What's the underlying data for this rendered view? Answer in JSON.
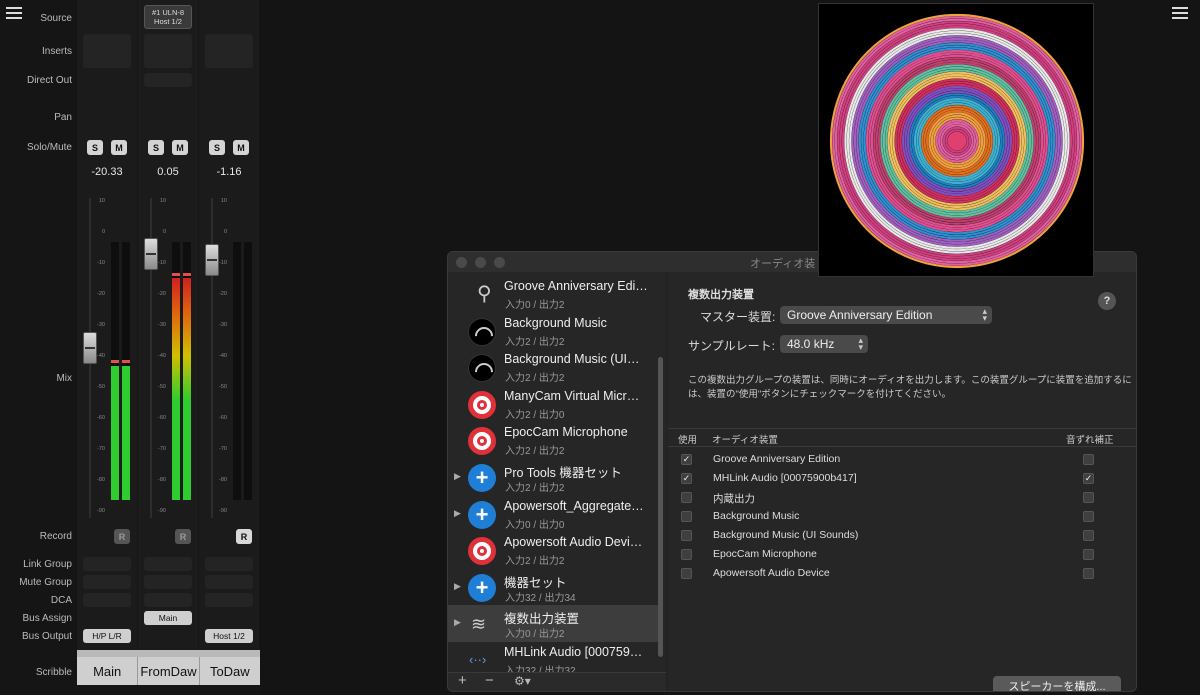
{
  "mixer": {
    "row_labels": {
      "source": "Source",
      "inserts": "Inserts",
      "direct_out": "Direct Out",
      "pan": "Pan",
      "solo_mute": "Solo/Mute",
      "mix": "Mix",
      "record": "Record",
      "link_group": "Link Group",
      "mute_group": "Mute Group",
      "dca": "DCA",
      "bus_assign": "Bus Assign",
      "bus_output": "Bus Output",
      "scribble": "Scribble"
    },
    "solo_label": "S",
    "mute_label": "M",
    "record_label": "R",
    "scale_labels": [
      "10",
      "0",
      "-10",
      "-20",
      "-30",
      "-40",
      "-50",
      "-60",
      "-70",
      "-80",
      "-90"
    ],
    "channels": [
      {
        "level": "-20.33",
        "scribble": "Main",
        "bus_output": "H/P L/R",
        "bus_assign": "",
        "record_armed": false,
        "meter": 0.52
      },
      {
        "level": "0.05",
        "scribble": "FromDaw",
        "source": "#1 ULN-8\nHost 1/2",
        "source_line1": "#1 ULN-8",
        "source_line2": "Host 1/2",
        "bus_output": "",
        "bus_assign": "Main",
        "record_armed": false,
        "meter": 0.86
      },
      {
        "level": "-1.16",
        "scribble": "ToDaw",
        "bus_output": "Host 1/2",
        "bus_assign": "",
        "record_armed": true,
        "meter": 0.0
      }
    ]
  },
  "window": {
    "title": "オーディオ装",
    "devices": [
      {
        "name": "Groove Anniversary Edi…",
        "sub": "入力0 / 出力2",
        "icon": "usb-icon"
      },
      {
        "name": "Background Music",
        "sub": "入力2 / 出力2",
        "icon": "background-music-icon"
      },
      {
        "name": "Background Music (UI…",
        "sub": "入力2 / 出力2",
        "icon": "background-music-icon"
      },
      {
        "name": "ManyCam Virtual Micr…",
        "sub": "入力2 / 出力0",
        "icon": "target-icon"
      },
      {
        "name": "EpocCam Microphone",
        "sub": "入力2 / 出力2",
        "icon": "target-icon"
      },
      {
        "name": "Pro Tools 機器セット",
        "sub": "入力2 / 出力2",
        "icon": "plus-icon"
      },
      {
        "name": "Apowersoft_Aggregate…",
        "sub": "入力0 / 出力0",
        "icon": "plus-icon"
      },
      {
        "name": "Apowersoft Audio Devi…",
        "sub": "入力2 / 出力2",
        "icon": "target-icon"
      },
      {
        "name": "機器セット",
        "sub": "入力32 / 出力34",
        "icon": "plus-icon"
      },
      {
        "name": "複数出力装置",
        "sub": "入力0 / 出力2",
        "icon": "multi-output-icon"
      },
      {
        "name": "MHLink Audio [000759…",
        "sub": "入力32 / 出力32",
        "icon": "mhlink-icon"
      }
    ],
    "bottom": {
      "add": "+",
      "remove": "−",
      "gear": "⚙︎▾"
    },
    "detail": {
      "title": "複数出力装置",
      "master_label": "マスター装置:",
      "master_value": "Groove Anniversary Edition",
      "rate_label": "サンプルレート:",
      "rate_value": "48.0 kHz",
      "help": "?",
      "description": "この複数出力グループの装置は、同時にオーディオを出力します。この装置グループに装置を追加するには、装置の\"使用\"ボタンにチェックマークを付けてください。",
      "col_use": "使用",
      "col_device": "オーディオ装置",
      "col_drift": "音ずれ補正",
      "rows": [
        {
          "name": "Groove Anniversary Edition",
          "use": true,
          "drift": false
        },
        {
          "name": "MHLink Audio [00075900b417]",
          "use": true,
          "drift": true
        },
        {
          "name": "内蔵出力",
          "use": false,
          "drift": false
        },
        {
          "name": "Background Music",
          "use": false,
          "drift": false
        },
        {
          "name": "Background Music (UI Sounds)",
          "use": false,
          "drift": false
        },
        {
          "name": "EpocCam Microphone",
          "use": false,
          "drift": false
        },
        {
          "name": "Apowersoft Audio Device",
          "use": false,
          "drift": false
        }
      ],
      "configure_button": "スピーカーを構成..."
    }
  },
  "colors": {
    "accent_blue": "#1f7fd6",
    "target_red": "#e0303a",
    "meter_green": "#2ecc2e"
  }
}
